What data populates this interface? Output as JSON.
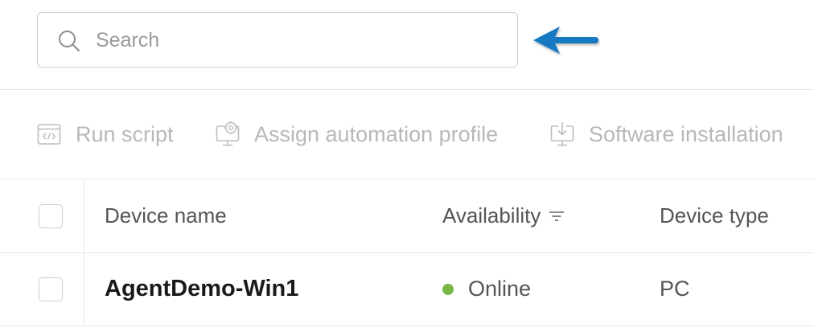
{
  "search": {
    "placeholder": "Search",
    "value": ""
  },
  "toolbar": {
    "run_script": {
      "label": "Run script",
      "icon": "code-window-icon"
    },
    "assign_profile": {
      "label": "Assign automation profile",
      "icon": "monitor-gear-icon"
    },
    "software_install": {
      "label": "Software installation",
      "icon": "monitor-download-icon"
    }
  },
  "table": {
    "columns": {
      "device_name": "Device name",
      "availability": "Availability",
      "device_type": "Device type"
    },
    "rows": [
      {
        "device_name": "AgentDemo-Win1",
        "availability": "Online",
        "device_type": "PC"
      }
    ]
  },
  "colors": {
    "online": "#7ab648",
    "arrow": "#1579c2",
    "disabled_text": "#b8b8b8"
  }
}
